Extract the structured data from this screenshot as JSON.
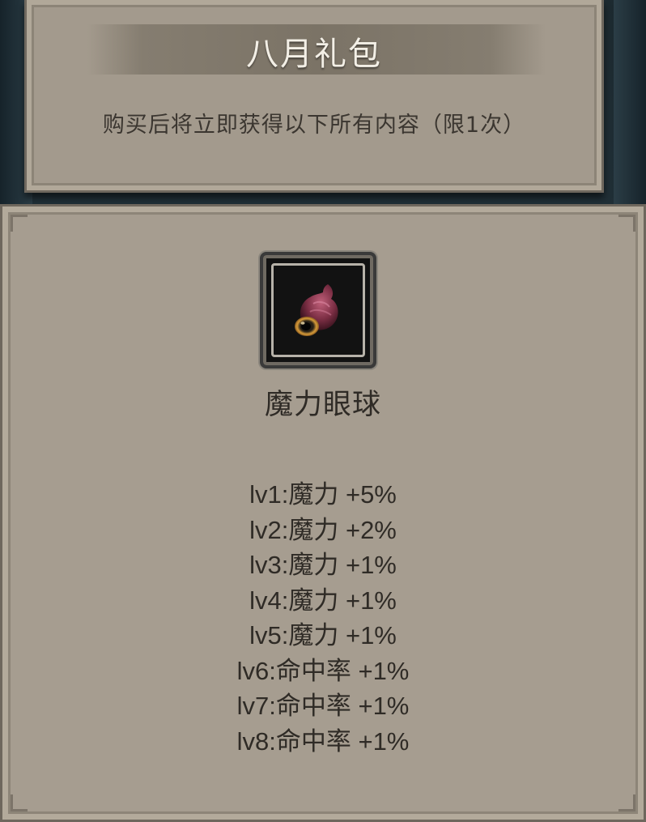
{
  "header": {
    "title": "八月礼包",
    "subtitle": "购买后将立即获得以下所有内容（限1次）"
  },
  "item": {
    "icon": "magic-eyeball-icon",
    "name": "魔力眼球"
  },
  "levels": [
    "lv1:魔力 +5%",
    "lv2:魔力 +2%",
    "lv3:魔力 +1%",
    "lv4:魔力 +1%",
    "lv5:魔力 +1%",
    "lv6:命中率 +1%",
    "lv7:命中率 +1%",
    "lv8:命中率 +1%"
  ],
  "colors": {
    "panel": "#a69d90",
    "title_text": "#f3efe6",
    "body_text": "#2f2b26"
  }
}
